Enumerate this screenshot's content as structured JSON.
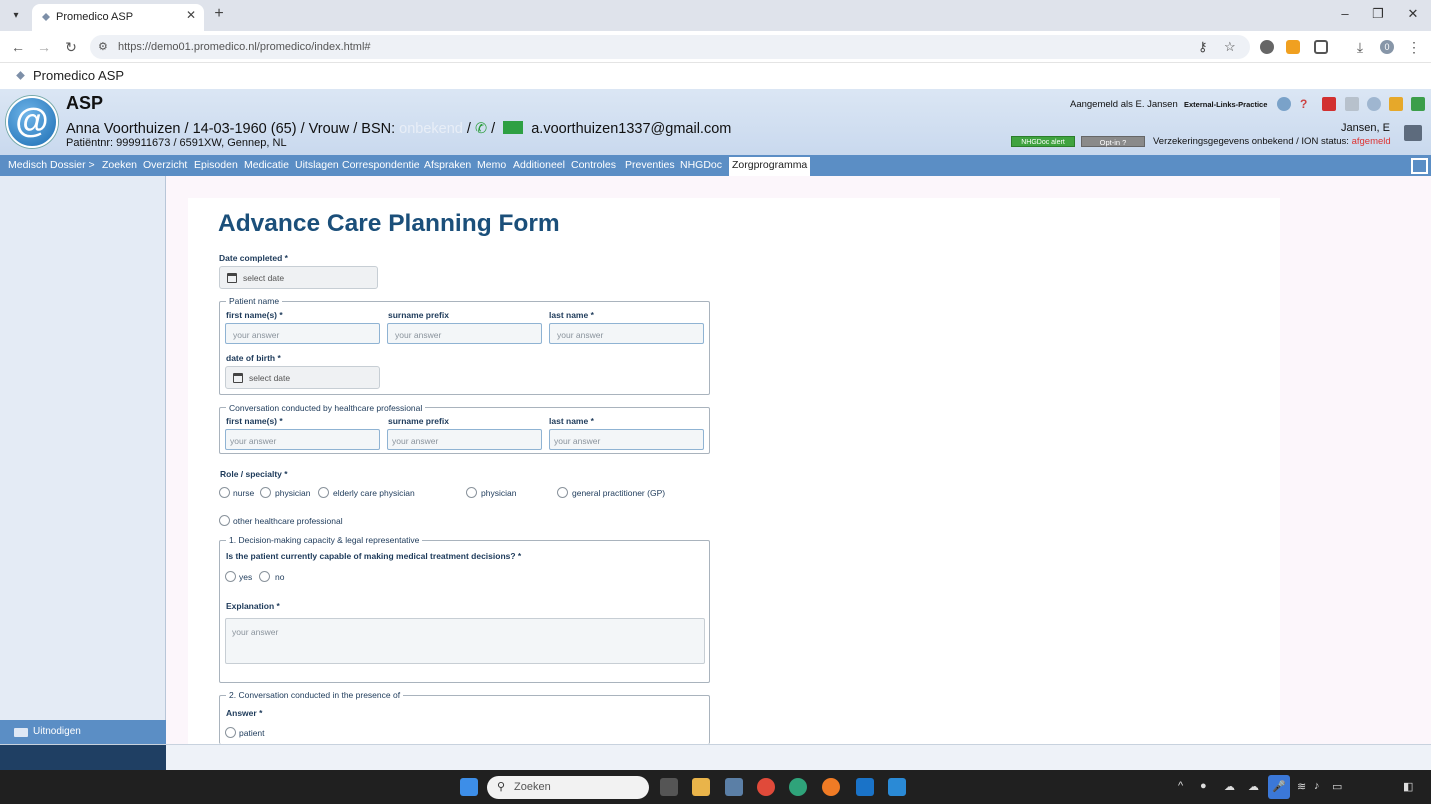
{
  "browser": {
    "tab_title": "Promedico ASP",
    "url": "https://demo01.promedico.nl/promedico/index.html#",
    "app_title": "Promedico ASP",
    "profile_initial": "0"
  },
  "header": {
    "app_name": "ASP",
    "patient_line": "Anna Voorthuizen / 14-03-1960 (65) / Vrouw / BSN:",
    "bsn_status": "onbekend",
    "email": "a.voorthuizen1337@gmail.com",
    "patient_sub": "Patiëntnr: 999911673 / 6591XW, Gennep, NL",
    "logged_in": "Aangemeld als E. Jansen",
    "external_links": "External-Links-Practice",
    "user_short": "Jansen, E",
    "nhgdoc_alert": "NHGDoc alert",
    "optin": "Opt-in ?",
    "insurance_text": "Verzekeringsgegevens onbekend / ION status:",
    "ion_status": "afgemeld",
    "logo_glyph": "@"
  },
  "menu": {
    "items": [
      "Medisch Dossier >",
      "Zoeken",
      "Overzicht",
      "Episoden",
      "Medicatie",
      "Uitslagen",
      "Correspondentie",
      "Afspraken",
      "Memo",
      "Additioneel",
      "Controles",
      "Preventies",
      "NHGDoc",
      "Zorgprogramma"
    ]
  },
  "sidebar": {
    "invite_label": "Uitnodigen"
  },
  "form": {
    "title": "Advance Care Planning Form",
    "date_completed_label": "Date completed *",
    "date_placeholder": "select date",
    "patient_name": {
      "legend": "Patient name",
      "first_name_label": "first name(s) *",
      "prefix_label": "surname prefix",
      "last_name_label": "last name *",
      "dob_label": "date of birth *",
      "placeholder": "your answer"
    },
    "conversation": {
      "legend": "Conversation conducted by healthcare professional",
      "first_name_label": "first name(s) *",
      "prefix_label": "surname prefix",
      "last_name_label": "last name *",
      "placeholder": "your answer"
    },
    "role": {
      "label": "Role / specialty *",
      "options": [
        "nurse",
        "physician",
        "elderly care physician",
        "physician",
        "general practitioner (GP)",
        "other healthcare professional"
      ]
    },
    "section1": {
      "legend": "1. Decision-making capacity & legal representative",
      "question": "Is the patient currently capable of making medical treatment decisions? *",
      "options": [
        "yes",
        "no"
      ],
      "explanation_label": "Explanation *",
      "placeholder": "your answer"
    },
    "section2": {
      "legend": "2. Conversation conducted in the presence of",
      "answer_label": "Answer *",
      "options": [
        "patient"
      ]
    }
  },
  "taskbar": {
    "search_placeholder": "Zoeken"
  }
}
